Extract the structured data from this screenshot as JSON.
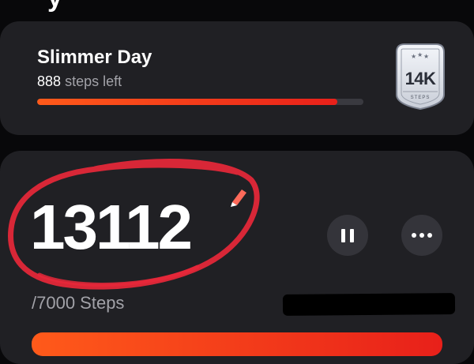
{
  "header": {
    "title_fragment": "y"
  },
  "challenge": {
    "title": "Slimmer Day",
    "steps_left_value": "888",
    "steps_left_label": "steps left",
    "progress": 0.92,
    "badge": {
      "label": "14K",
      "sub": "STEPS",
      "icon": "medal-badge-icon"
    }
  },
  "steps": {
    "count": "13112",
    "goal": "/7000 Steps",
    "progress": 1.0,
    "edit_icon": "pencil-icon",
    "pause_icon": "pause-icon",
    "more_icon": "more-icon"
  },
  "colors": {
    "accent_start": "#ff5a1a",
    "accent_end": "#e8201a",
    "card": "#202024",
    "background": "#08080a",
    "annotation": "#e8283a"
  }
}
